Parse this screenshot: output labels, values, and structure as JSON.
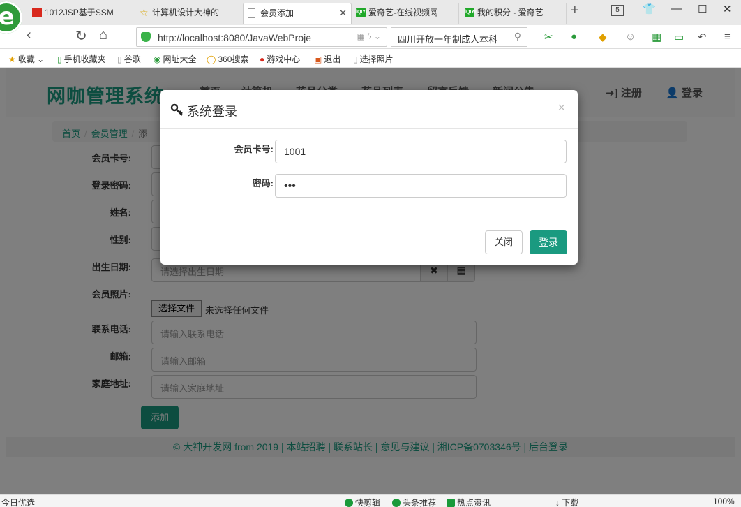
{
  "browser": {
    "tabs": [
      {
        "title": "1012JSP基于SSM",
        "favicon": "red-square-icon"
      },
      {
        "title": "计算机设计大神的",
        "favicon": "star-icon"
      },
      {
        "title": "会员添加",
        "favicon": "document-icon",
        "active": true
      },
      {
        "title": "爱奇艺-在线视频网",
        "favicon": "iqiyi-icon"
      },
      {
        "title": "我的积分 - 爱奇艺",
        "favicon": "iqiyi-icon"
      }
    ],
    "iqiyi_mark": "iQIYI",
    "tab_count": "5",
    "url": "http://localhost:8080/JavaWebProje",
    "search_text": "四川开放一年制成人本科",
    "bookmarks": [
      "收藏",
      "手机收藏夹",
      "谷歌",
      "网址大全",
      "360搜索",
      "游戏中心",
      "退出",
      "选择照片"
    ]
  },
  "site": {
    "brand": "网咖管理系统",
    "nav": [
      "首页",
      "计算机",
      "花品分类",
      "花品列表",
      "留言反馈",
      "新闻公告"
    ],
    "register": "注册",
    "login": "登录",
    "breadcrumb": [
      "首页",
      "会员管理",
      "添"
    ],
    "form": {
      "labels": [
        "会员卡号:",
        "登录密码:",
        "姓名:",
        "性别:",
        "出生日期:",
        "会员照片:",
        "联系电话:",
        "邮箱:",
        "家庭地址:"
      ],
      "birth_placeholder": "请选择出生日期",
      "phone_placeholder": "请输入联系电话",
      "email_placeholder": "请输入邮箱",
      "address_placeholder": "请输入家庭地址",
      "file_button": "选择文件",
      "file_status": "未选择任何文件",
      "submit": "添加"
    },
    "footer": "© 大神开发网 from 2019 | 本站招聘 | 联系站长 | 意见与建议 | 湘ICP备0703346号 | 后台登录"
  },
  "modal": {
    "title": "系统登录",
    "card_label": "会员卡号:",
    "card_value": "1001",
    "password_label": "密码:",
    "password_value": "•••",
    "close_button": "关闭",
    "login_button": "登录"
  },
  "statusbar": {
    "left": "今日优选",
    "items": [
      "快剪辑",
      "头条推荐",
      "热点资讯",
      "下载"
    ],
    "zoom": "100%"
  },
  "colors": {
    "accent": "#1a9a80",
    "backdrop": "rgba(0,0,0,0.5)"
  }
}
